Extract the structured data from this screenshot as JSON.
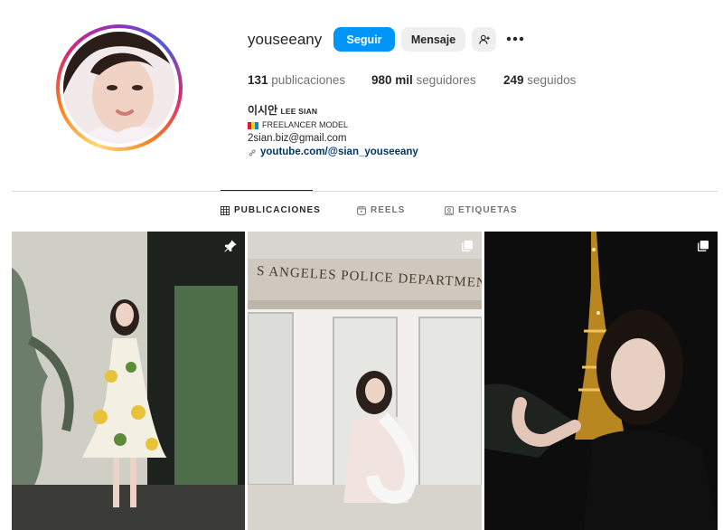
{
  "profile": {
    "username": "youseeany",
    "buttons": {
      "follow": "Seguir",
      "message": "Mensaje"
    },
    "stats": {
      "posts_count": "131",
      "posts_label": "publicaciones",
      "followers_count": "980 mil",
      "followers_label": "seguidores",
      "following_count": "249",
      "following_label": "seguidos"
    },
    "bio": {
      "name": "이시안",
      "name_latin": "LEE SIAN",
      "category": "FREELANCER MODEL",
      "email": "2sian.biz@gmail.com",
      "link": "youtube.com/@sian_youseeany"
    }
  },
  "tabs": {
    "posts": "PUBLICACIONES",
    "reels": "REELS",
    "tagged": "ETIQUETAS"
  },
  "grid": {
    "sign_text": "S ANGELES POLICE DEPARTMENT"
  },
  "colors": {
    "accent": "#0095f6",
    "link": "#00376b",
    "secondary_button": "#efefef",
    "muted_text": "#737373"
  },
  "icons": {
    "add_user": "person-plus-icon",
    "more": "ellipsis-icon",
    "posts_tab": "grid-icon",
    "reels_tab": "reels-icon",
    "tagged_tab": "tag-icon",
    "pinned": "pin-icon",
    "carousel": "carousel-icon",
    "link": "link-icon"
  }
}
